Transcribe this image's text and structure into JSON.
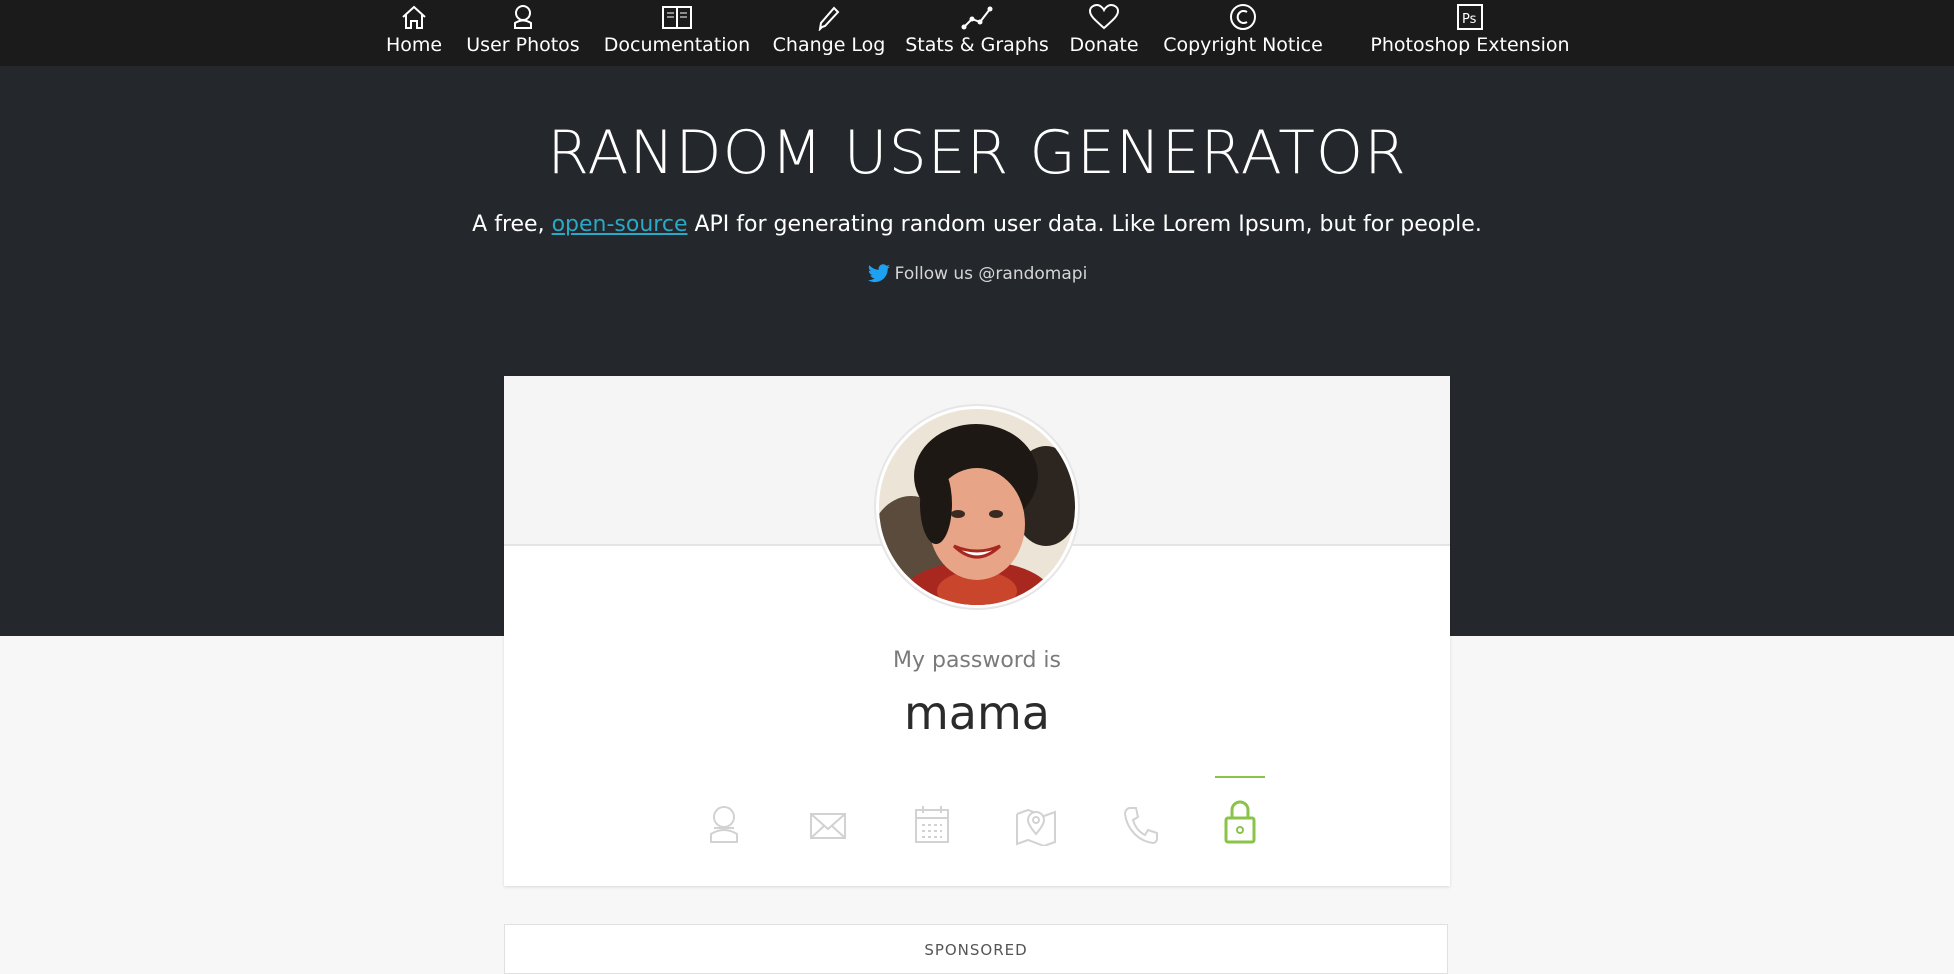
{
  "nav": {
    "items": [
      {
        "label": "Home",
        "icon": "home-icon"
      },
      {
        "label": "User Photos",
        "icon": "user-icon"
      },
      {
        "label": "Documentation",
        "icon": "book-icon"
      },
      {
        "label": "Change Log",
        "icon": "pencil-icon"
      },
      {
        "label": "Stats & Graphs",
        "icon": "graph-icon"
      },
      {
        "label": "Donate",
        "icon": "heart-icon"
      },
      {
        "label": "Copyright Notice",
        "icon": "copyright-icon"
      },
      {
        "label": "Photoshop Extension",
        "icon": "photoshop-icon"
      }
    ]
  },
  "hero": {
    "title": "RANDOM USER GENERATOR",
    "subtitle_prefix": "A free, ",
    "subtitle_link": "open-source",
    "subtitle_suffix": " API for generating random user data. Like Lorem Ipsum, but for people.",
    "follow_text": "Follow us @randomapi"
  },
  "user_card": {
    "label": "My password is",
    "value": "mama",
    "icons": [
      {
        "icon": "user-icon",
        "active": false
      },
      {
        "icon": "envelope-icon",
        "active": false
      },
      {
        "icon": "calendar-icon",
        "active": false
      },
      {
        "icon": "map-icon",
        "active": false
      },
      {
        "icon": "phone-icon",
        "active": false
      },
      {
        "icon": "lock-icon",
        "active": true
      }
    ]
  },
  "sponsored": {
    "label": "SPONSORED"
  },
  "colors": {
    "accent": "#8bc34a",
    "link": "#2aa8c6",
    "twitter": "#1da1f2",
    "nav_bg": "#1b1b1b",
    "hero_bg": "#24272b"
  }
}
